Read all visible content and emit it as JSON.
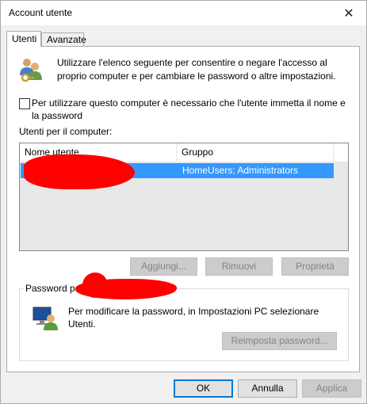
{
  "window": {
    "title": "Account utente",
    "close_glyph": "✕"
  },
  "tabs": [
    {
      "label": "Utenti",
      "active": true
    },
    {
      "label": "Avanzate",
      "active": false
    }
  ],
  "users_tab": {
    "intro_icon": "users-key-icon",
    "intro_text": "Utilizzare l'elenco seguente per consentire o negare l'accesso al proprio computer e per cambiare le password o altre impostazioni.",
    "require_login": {
      "checked": false,
      "label": "Per utilizzare questo computer è necessario che l'utente immetta il nome e la password"
    },
    "list_label": "Utenti per il computer:",
    "columns": [
      "Nome utente",
      "Gruppo"
    ],
    "rows": [
      {
        "user": "",
        "group": "HomeUsers; Administrators",
        "selected": true,
        "icon": "user-icon"
      }
    ],
    "buttons": {
      "add": "Aggiungi...",
      "remove": "Rimuovi",
      "properties": "Proprietà"
    },
    "password_group": {
      "title": "Password per",
      "icon": "pc-user-icon",
      "text": "Per modificare la password, in Impostazioni PC selezionare Utenti.",
      "reset_button": "Reimposta password..."
    }
  },
  "footer": {
    "ok": "OK",
    "cancel": "Annulla",
    "apply": "Applica"
  },
  "colors": {
    "selection": "#3399ff",
    "redaction": "#ff0000",
    "accent": "#0078d7"
  }
}
